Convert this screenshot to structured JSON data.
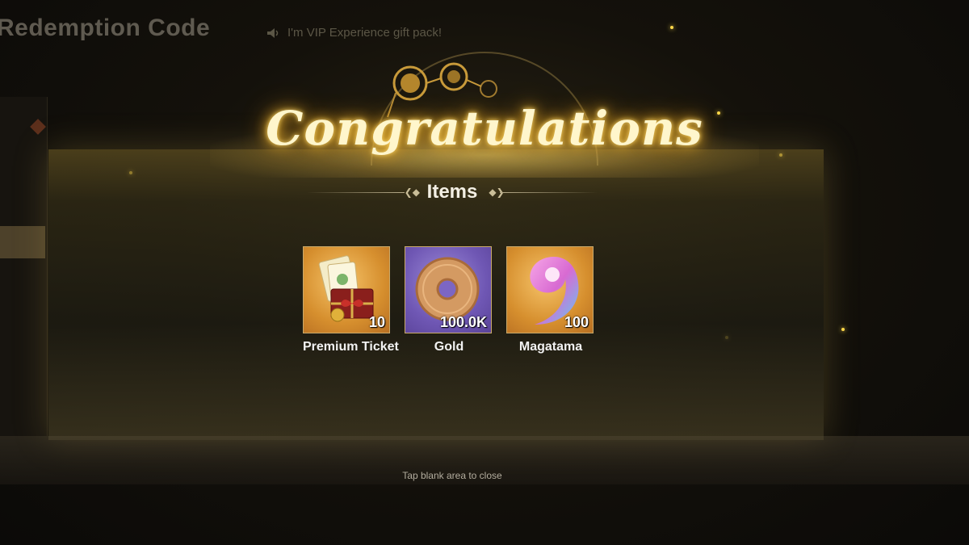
{
  "background": {
    "title": "Redemption Code",
    "notice": "I'm VIP Experience gift pack!"
  },
  "popup": {
    "heading": "Congratulations",
    "section_title": "Items",
    "items": [
      {
        "name": "Premium Ticket",
        "count": "10",
        "icon": "premium-ticket-icon",
        "bg": "#d68f2e"
      },
      {
        "name": "Gold",
        "count": "100.0K",
        "icon": "gold-coin-icon",
        "bg": "#6f57b4"
      },
      {
        "name": "Magatama",
        "count": "100",
        "icon": "magatama-icon",
        "bg": "#d68f2e"
      }
    ],
    "close_hint": "Tap blank area to close"
  },
  "colors": {
    "glow": "#f4b92e",
    "text_light": "#fff6cc"
  }
}
